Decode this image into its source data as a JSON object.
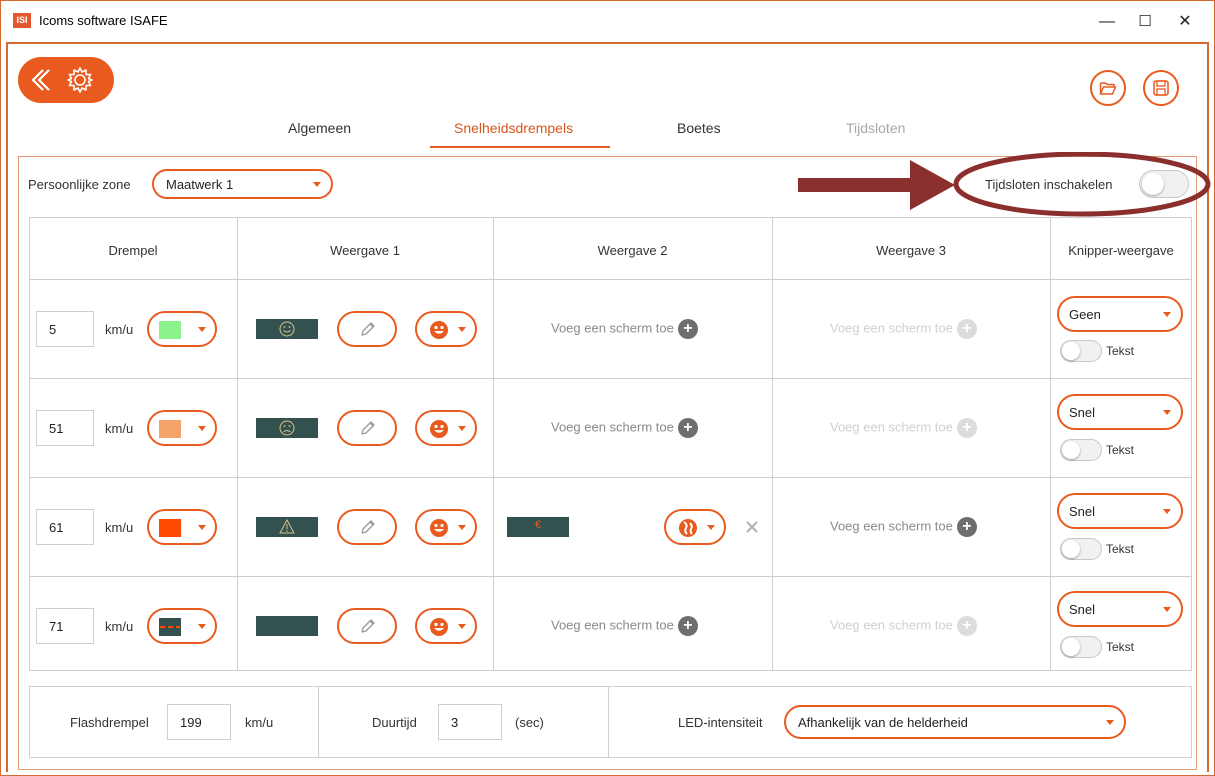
{
  "window": {
    "title": "Icoms software ISAFE",
    "icon_text": "ISI",
    "minimize": "—",
    "maximize": "☐",
    "close": "✕"
  },
  "toolbar": {
    "back_icon": "back-chevron-icon",
    "settings_icon": "gear-icon",
    "open_icon": "folder-open-icon",
    "save_icon": "save-disk-icon"
  },
  "tabs": [
    {
      "label": "Algemeen",
      "state": "normal"
    },
    {
      "label": "Snelheidsdrempels",
      "state": "active"
    },
    {
      "label": "Boetes",
      "state": "normal"
    },
    {
      "label": "Tijdsloten",
      "state": "disabled"
    }
  ],
  "zone": {
    "label": "Persoonlijke zone",
    "value": "Maatwerk 1"
  },
  "timeslots_toggle": {
    "label": "Tijdsloten inschakelen",
    "on": false
  },
  "table": {
    "headers": [
      "Drempel",
      "Weergave 1",
      "Weergave 2",
      "Weergave 3",
      "Knipper-weergave"
    ],
    "add_screen_label": "Voeg een scherm toe",
    "unit": "km/u",
    "rows": [
      {
        "threshold": "5",
        "color": "#8cf28c",
        "screen1": "smiley-happy",
        "w2": "add",
        "w3": "add-faded",
        "blink": "Geen",
        "tekst": "Tekst"
      },
      {
        "threshold": "51",
        "color": "#f4a36b",
        "screen1": "smiley-sad",
        "w2": "add",
        "w3": "add-faded",
        "blink": "Snel",
        "tekst": "Tekst"
      },
      {
        "threshold": "61",
        "color": "#ff4800",
        "screen1": "warning",
        "w2": "euro",
        "w3": "add",
        "blink": "Snel",
        "tekst": "Tekst"
      },
      {
        "threshold": "71",
        "color": "dashes",
        "screen1": "blank",
        "w2": "add",
        "w3": "add-faded",
        "blink": "Snel",
        "tekst": "Tekst"
      }
    ],
    "euro_text": "€"
  },
  "bottom": {
    "flash_label": "Flashdrempel",
    "flash_value": "199",
    "flash_unit": "km/u",
    "duration_label": "Duurtijd",
    "duration_value": "3",
    "duration_unit": "(sec)",
    "led_label": "LED-intensiteit",
    "led_value": "Afhankelijk van de helderheid"
  },
  "colors": {
    "accent": "#e95a1e",
    "screen": "#33514f",
    "annotation": "#8b2e2e"
  }
}
